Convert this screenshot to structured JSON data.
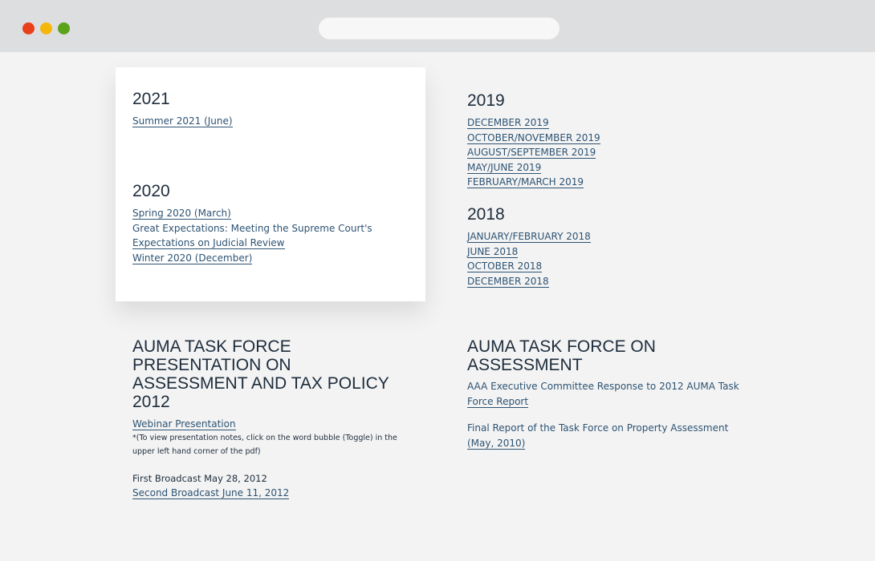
{
  "browser": {
    "dots": [
      "close",
      "minimize",
      "maximize"
    ],
    "address": ""
  },
  "y2021": {
    "title": "2021",
    "links": [
      "Summer 2021 (June)"
    ]
  },
  "y2020": {
    "title": "2020",
    "link1": "Spring 2020 (March)",
    "link2_line1": "Great Expectations:  Meeting the Supreme Court's",
    "link2_line2": "Expectations on Judicial Review",
    "link3": "Winter 2020 (December)"
  },
  "y2019": {
    "title": "2019",
    "links": [
      "DECEMBER 2019",
      "OCTOBER/NOVEMBER 2019",
      "AUGUST/SEPTEMBER 2019",
      "MAY/JUNE 2019",
      "FEBRUARY/MARCH 2019"
    ]
  },
  "y2018": {
    "title": "2018",
    "links": [
      "JANUARY/FEBRUARY 2018",
      "JUNE 2018",
      "OCTOBER 2018",
      "DECEMBER 2018"
    ]
  },
  "tax_policy": {
    "title_lines": [
      "AUMA TASK FORCE",
      "PRESENTATION ON",
      "ASSESSMENT AND TAX POLICY",
      "2012"
    ],
    "webinar": "Webinar Presentation",
    "note_line1": "*(To view presentation notes, click on the word bubble (Toggle) in the",
    "note_line2": "upper left hand corner of the pdf)",
    "first_broadcast": "First Broadcast May 28, 2012",
    "second_broadcast": "Second Broadcast June 11, 2012"
  },
  "assessment": {
    "title_lines": [
      "AUMA TASK FORCE ON",
      "ASSESSMENT"
    ],
    "response_line1": "AAA Executive Committee Response to 2012 AUMA Task",
    "response_line2": "Force Report",
    "final_line1": "Final Report of the Task Force on Property Assessment",
    "final_line2": "(May, 2010)"
  },
  "colors": {
    "link": "#2d5373",
    "heading": "#1d2c3c",
    "background": "#f3f3f3",
    "card": "#ffffff"
  }
}
